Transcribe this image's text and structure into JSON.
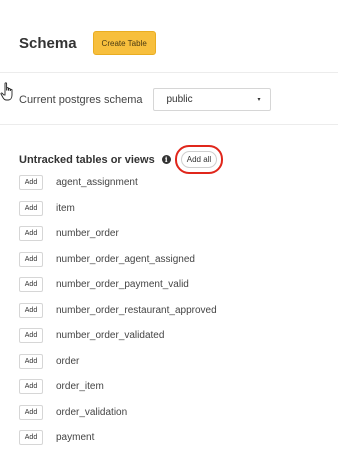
{
  "header": {
    "title": "Schema",
    "create_table_label": "Create Table"
  },
  "schema_selector": {
    "label": "Current postgres schema",
    "selected": "public",
    "chevron": "▾"
  },
  "untracked": {
    "title": "Untracked tables or views",
    "info_glyph": "i",
    "add_all_label": "Add all",
    "add_label": "Add",
    "highlight_color": "#e0261b",
    "tables": [
      "agent_assignment",
      "item",
      "number_order",
      "number_order_agent_assigned",
      "number_order_payment_valid",
      "number_order_restaurant_approved",
      "number_order_validated",
      "order",
      "order_item",
      "order_validation",
      "payment"
    ]
  },
  "colors": {
    "accent": "#f7bf3d",
    "divider": "#ececec"
  }
}
